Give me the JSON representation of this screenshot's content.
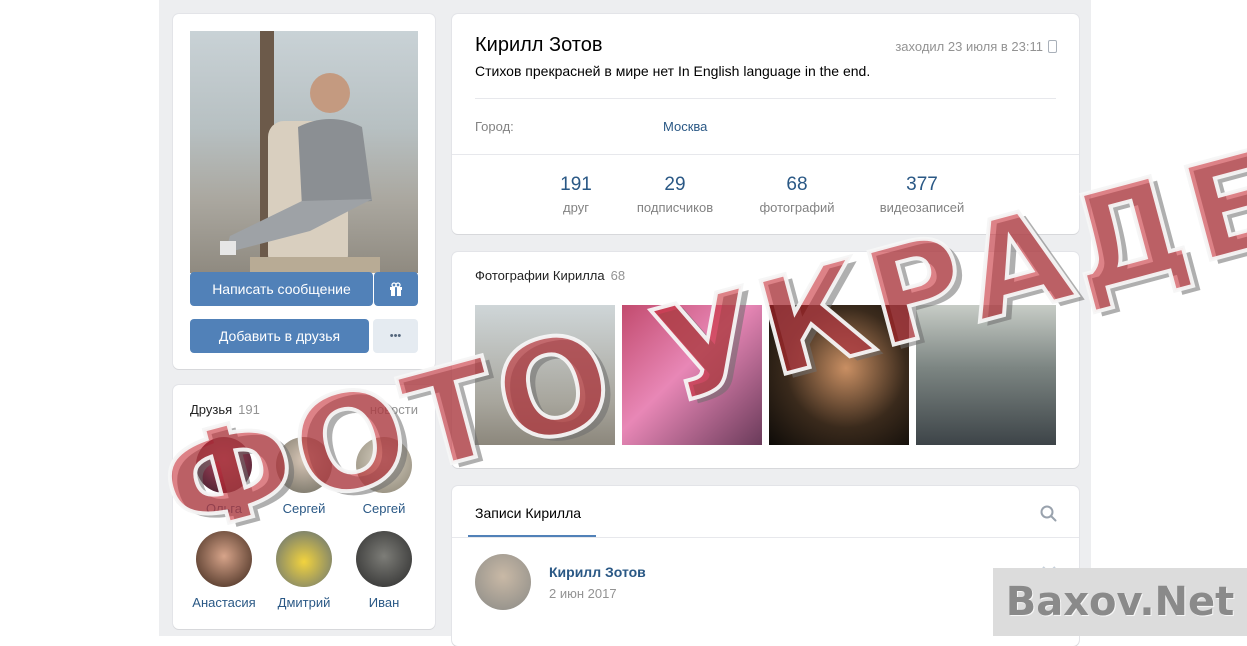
{
  "profile": {
    "name": "Кирилл Зотов",
    "last_seen": "заходил 23 июля в 23:11",
    "status": "Стихов прекрасней в мире нет In English language in the end.",
    "city_label": "Город:",
    "city_value": "Москва"
  },
  "stats": [
    {
      "num": "191",
      "label": "друг"
    },
    {
      "num": "29",
      "label": "подписчиков"
    },
    {
      "num": "68",
      "label": "фотографий"
    },
    {
      "num": "377",
      "label": "видеозаписей"
    }
  ],
  "actions": {
    "message_label": "Написать сообщение",
    "add_friend_label": "Добавить в друзья",
    "more_label": "•••"
  },
  "friends": {
    "title": "Друзья",
    "count": "191",
    "new_label": "новости",
    "items": [
      {
        "name": "Ольга"
      },
      {
        "name": "Сергей"
      },
      {
        "name": "Сергей"
      },
      {
        "name": "Анастасия"
      },
      {
        "name": "Дмитрий"
      },
      {
        "name": "Иван"
      }
    ]
  },
  "photos": {
    "title": "Фотографии Кирилла",
    "count": "68"
  },
  "wall": {
    "tab_label": "Записи Кирилла",
    "post_author": "Кирилл Зотов",
    "post_date": "2 июн 2017"
  },
  "overlay": {
    "stamp_text": "ФОТО УКРАДЕНО",
    "watermark_text": "Baxov.Net"
  },
  "colors": {
    "accent": "#5181b8",
    "link": "#2a5885",
    "stamp": "#c42830"
  }
}
